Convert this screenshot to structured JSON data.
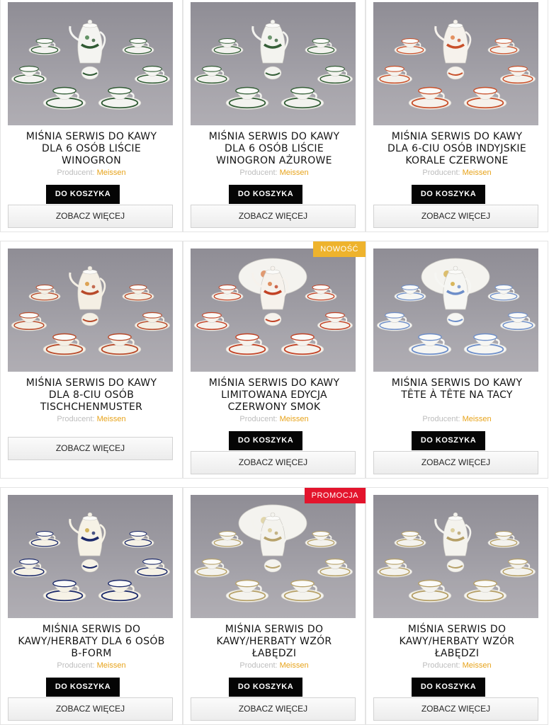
{
  "products": [
    {
      "title_lines": [
        "MIŚNIA SERWIS DO KAWY",
        "DLA 6 OSÓB LIŚCIE",
        "WINOGRON"
      ],
      "producer_label": "Producent:",
      "brand": "Meissen",
      "cart_label": "DO KOSZYKA",
      "more_label": "ZOBACZ WIĘCEJ",
      "badge": "",
      "pattern": "green-vine"
    },
    {
      "title_lines": [
        "MIŚNIA SERWIS DO KAWY",
        "DLA 6 OSÓB LIŚCIE",
        "WINOGRON AŻUROWE"
      ],
      "producer_label": "Producent:",
      "brand": "Meissen",
      "cart_label": "DO KOSZYKA",
      "more_label": "ZOBACZ WIĘCEJ",
      "badge": "",
      "pattern": "green-vine-openwork"
    },
    {
      "title_lines": [
        "MIŚNIA SERWIS DO KAWY",
        "DLA 6-CIU OSÓB INDYJSKIE",
        "KORALE CZERWONE"
      ],
      "producer_label": "Producent:",
      "brand": "Meissen",
      "cart_label": "DO KOSZYKA",
      "more_label": "ZOBACZ WIĘCEJ",
      "badge": "",
      "pattern": "red-indian"
    },
    {
      "title_lines": [
        "MIŚNIA SERWIS DO KAWY",
        "DLA 8-CIU OSÓB",
        "TISCHCHENMUSTER"
      ],
      "producer_label": "Producent:",
      "brand": "Meissen",
      "cart_label": "",
      "more_label": "ZOBACZ WIĘCEJ",
      "badge": "",
      "pattern": "tischchen"
    },
    {
      "title_lines": [
        "MIŚNIA SERWIS DO KAWY",
        "LIMITOWANA EDYCJA",
        "CZERWONY SMOK"
      ],
      "producer_label": "Producent:",
      "brand": "Meissen",
      "cart_label": "DO KOSZYKA",
      "more_label": "ZOBACZ WIĘCEJ",
      "badge": "NOWOŚĆ",
      "badge_color": "#eeb32d",
      "pattern": "red-dragon"
    },
    {
      "title_lines": [
        "MIŚNIA SERWIS DO KAWY",
        "TÊTE À TÊTE NA TACY"
      ],
      "producer_label": "Producent:",
      "brand": "Meissen",
      "cart_label": "DO KOSZYKA",
      "more_label": "ZOBACZ WIĘCEJ",
      "badge": "",
      "pattern": "flowers-tray"
    },
    {
      "title_lines": [
        "MIŚNIA SERWIS DO",
        "KAWY/HERBATY DLA 6 OSÓB",
        "B-FORM"
      ],
      "producer_label": "Producent:",
      "brand": "Meissen",
      "cart_label": "DO KOSZYKA",
      "more_label": "ZOBACZ WIĘCEJ",
      "badge": "",
      "pattern": "cobalt-gold"
    },
    {
      "title_lines": [
        "MIŚNIA SERWIS DO",
        "KAWY/HERBATY WZÓR",
        "ŁABĘDZI"
      ],
      "producer_label": "Producent:",
      "brand": "Meissen",
      "cart_label": "DO KOSZYKA",
      "more_label": "ZOBACZ WIĘCEJ",
      "badge": "PROMOCJA",
      "badge_color": "#e3142c",
      "pattern": "swan"
    },
    {
      "title_lines": [
        "MIŚNIA SERWIS DO",
        "KAWY/HERBATY WZÓR",
        "ŁABĘDZI"
      ],
      "producer_label": "Producent:",
      "brand": "Meissen",
      "cart_label": "DO KOSZYKA",
      "more_label": "ZOBACZ WIĘCEJ",
      "badge": "",
      "pattern": "swan-plain"
    }
  ],
  "colors": {
    "brand": "#e7a31a",
    "cart_button": "#050505",
    "badge_new": "#eeb32d",
    "badge_promo": "#e3142c"
  }
}
